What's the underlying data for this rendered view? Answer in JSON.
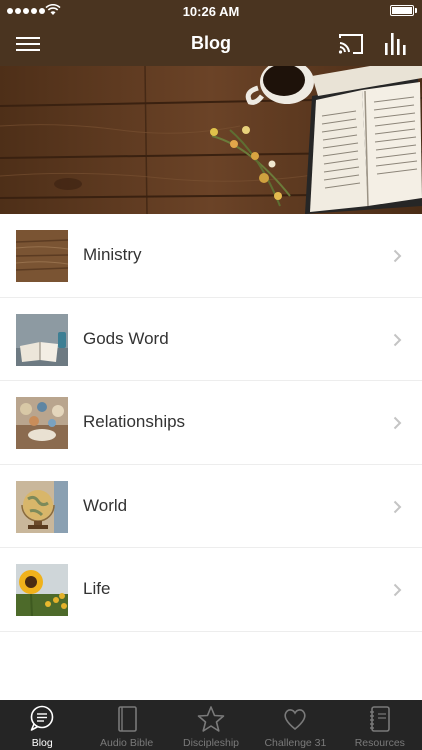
{
  "status": {
    "time": "10:26 AM"
  },
  "nav": {
    "title": "Blog",
    "menu_icon": "hamburger-menu-icon",
    "cast_icon": "cast-icon",
    "stats_icon": "bar-chart-icon",
    "bar_color": "#4a3420"
  },
  "hero": {
    "description_icon": "hero-image"
  },
  "categories": [
    {
      "label": "Ministry",
      "thumb": "wood-texture"
    },
    {
      "label": "Gods Word",
      "thumb": "open-bible"
    },
    {
      "label": "Relationships",
      "thumb": "table-setting"
    },
    {
      "label": "World",
      "thumb": "globe"
    },
    {
      "label": "Life",
      "thumb": "sunflowers"
    }
  ],
  "tabs": [
    {
      "label": "Blog",
      "icon": "chat-bubble-icon",
      "active": true
    },
    {
      "label": "Audio Bible",
      "icon": "book-icon",
      "active": false
    },
    {
      "label": "Discipleship",
      "icon": "star-icon",
      "active": false
    },
    {
      "label": "Challenge 31",
      "icon": "heart-icon",
      "active": false
    },
    {
      "label": "Resources",
      "icon": "notebook-icon",
      "active": false
    }
  ],
  "colors": {
    "tabbar": "#252525",
    "active_tab": "#ffffff",
    "inactive_tab": "#7a7a7a"
  }
}
